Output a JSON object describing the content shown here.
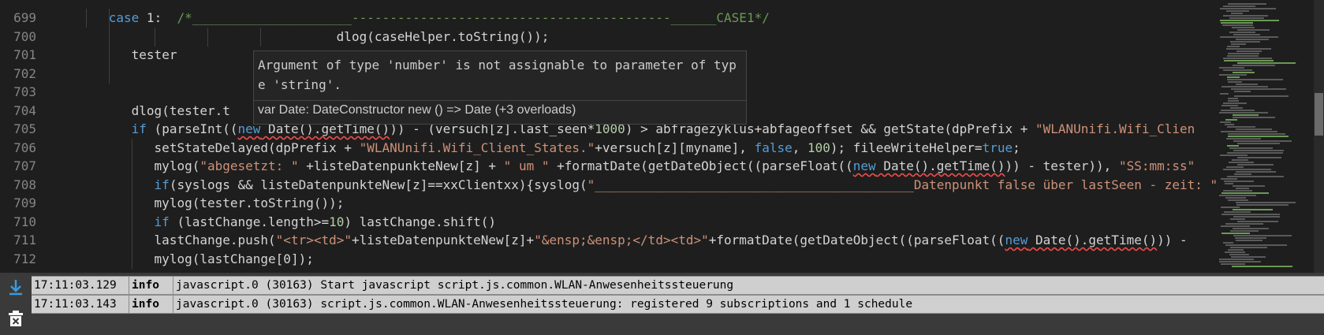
{
  "editor": {
    "lines": [
      {
        "num": "699",
        "indent": 6,
        "guides": [
          3,
          6
        ],
        "tokens": [
          {
            "t": "case",
            "k": "kw"
          },
          {
            "t": " 1:  ",
            "k": "plain"
          },
          {
            "t": "/*_____________________",
            "k": "cm"
          },
          {
            "t": "------------------------------------------",
            "k": "cm"
          },
          {
            "t": "______CASE1*/",
            "k": "cm"
          }
        ]
      },
      {
        "num": "700",
        "indent": 36,
        "guides": [
          6,
          12,
          19,
          26
        ],
        "tokens": [
          {
            "t": "dlog(caseHelper.toString());",
            "k": "plain"
          }
        ]
      },
      {
        "num": "701",
        "indent": 9,
        "guides": [
          6
        ],
        "tokens": [
          {
            "t": "tester",
            "k": "plain"
          }
        ]
      },
      {
        "num": "702",
        "indent": 0,
        "guides": [
          6
        ],
        "tokens": []
      },
      {
        "num": "703",
        "indent": 0,
        "guides": [],
        "tokens": []
      },
      {
        "num": "704",
        "indent": 9,
        "guides": [],
        "tokens": [
          {
            "t": "dlog(tester.t",
            "k": "plain"
          }
        ]
      },
      {
        "num": "705",
        "indent": 9,
        "guides": [],
        "tokens": [
          {
            "t": "if",
            "k": "kw"
          },
          {
            "t": " (parseInt((",
            "k": "plain"
          },
          {
            "t": "new",
            "k": "kw",
            "sq": true
          },
          {
            "t": " Date().getTime()",
            "k": "plain",
            "sq": true
          },
          {
            "t": ")) - (versuch[z].last_seen*",
            "k": "plain"
          },
          {
            "t": "1000",
            "k": "num"
          },
          {
            "t": ") > abfragezyklus+abfageoffset && getState(dpPrefix + ",
            "k": "plain"
          },
          {
            "t": "\"WLANUnifi.Wifi_Clien",
            "k": "str"
          }
        ]
      },
      {
        "num": "706",
        "indent": 12,
        "guides": [
          9
        ],
        "tokens": [
          {
            "t": "setStateDelayed(dpPrefix + ",
            "k": "plain"
          },
          {
            "t": "\"WLANUnifi.Wifi_Client_States.\"",
            "k": "str"
          },
          {
            "t": "+versuch[z][myname], ",
            "k": "plain"
          },
          {
            "t": "false",
            "k": "kw"
          },
          {
            "t": ", ",
            "k": "plain"
          },
          {
            "t": "100",
            "k": "num"
          },
          {
            "t": "); fileeWriteHelper=",
            "k": "plain"
          },
          {
            "t": "true",
            "k": "kw"
          },
          {
            "t": ";",
            "k": "plain"
          }
        ]
      },
      {
        "num": "707",
        "indent": 12,
        "guides": [
          9
        ],
        "tokens": [
          {
            "t": "mylog(",
            "k": "plain"
          },
          {
            "t": "\"abgesetzt: \"",
            "k": "str"
          },
          {
            "t": " +listeDatenpunkteNew[z] + ",
            "k": "plain"
          },
          {
            "t": "\" um \"",
            "k": "str"
          },
          {
            "t": " +formatDate(getDateObject((parseFloat((",
            "k": "plain"
          },
          {
            "t": "new",
            "k": "kw",
            "sq": true
          },
          {
            "t": " Date().getTime()",
            "k": "plain",
            "sq": true
          },
          {
            "t": ")) - tester)), ",
            "k": "plain"
          },
          {
            "t": "\"SS:mm:ss\"",
            "k": "str"
          }
        ]
      },
      {
        "num": "708",
        "indent": 12,
        "guides": [
          9
        ],
        "tokens": [
          {
            "t": "if",
            "k": "kw"
          },
          {
            "t": "(syslogs && listeDatenpunkteNew[z]==xxClientxx){syslog(",
            "k": "plain"
          },
          {
            "t": "\"__________________________________________",
            "k": "str"
          },
          {
            "t": "Datenpunkt false über lastSeen - zeit: \"",
            "k": "str"
          }
        ]
      },
      {
        "num": "709",
        "indent": 12,
        "guides": [
          9
        ],
        "tokens": [
          {
            "t": "mylog(tester.toString());",
            "k": "plain"
          }
        ]
      },
      {
        "num": "710",
        "indent": 12,
        "guides": [
          9
        ],
        "tokens": [
          {
            "t": "if",
            "k": "kw"
          },
          {
            "t": " (lastChange.length>=",
            "k": "plain"
          },
          {
            "t": "10",
            "k": "num"
          },
          {
            "t": ") lastChange.shift()",
            "k": "plain"
          }
        ]
      },
      {
        "num": "711",
        "indent": 12,
        "guides": [
          9
        ],
        "tokens": [
          {
            "t": "lastChange.push(",
            "k": "plain"
          },
          {
            "t": "\"<tr><td>\"",
            "k": "str"
          },
          {
            "t": "+listeDatenpunkteNew[z]+",
            "k": "plain"
          },
          {
            "t": "\"&ensp;&ensp;</td><td>\"",
            "k": "str"
          },
          {
            "t": "+formatDate(getDateObject((parseFloat((",
            "k": "plain"
          },
          {
            "t": "new",
            "k": "kw",
            "sq": true
          },
          {
            "t": " Date().getTime()",
            "k": "plain",
            "sq": true
          },
          {
            "t": ")) - ",
            "k": "plain"
          }
        ]
      },
      {
        "num": "712",
        "indent": 12,
        "guides": [
          9
        ],
        "tokens": [
          {
            "t": "mylog(lastChange[0]);",
            "k": "plain"
          }
        ]
      }
    ]
  },
  "hover": {
    "message": "Argument of type 'number' is not assignable to parameter of type 'string'.",
    "signature": "var Date: DateConstructor new () => Date (+3 overloads)"
  },
  "log": {
    "tools": {
      "scroll_down_icon": "scroll-down-icon",
      "clear_log_icon": "clear-log-icon"
    },
    "rows": [
      {
        "time": "17:11:03.129",
        "severity": "info",
        "message": "javascript.0 (30163) Start javascript script.js.common.WLAN-Anwesenheitssteuerung"
      },
      {
        "time": "17:11:03.143",
        "severity": "info",
        "message": "javascript.0 (30163) script.js.common.WLAN-Anwesenheitssteuerung: registered 9 subscriptions and 1 schedule"
      }
    ]
  }
}
